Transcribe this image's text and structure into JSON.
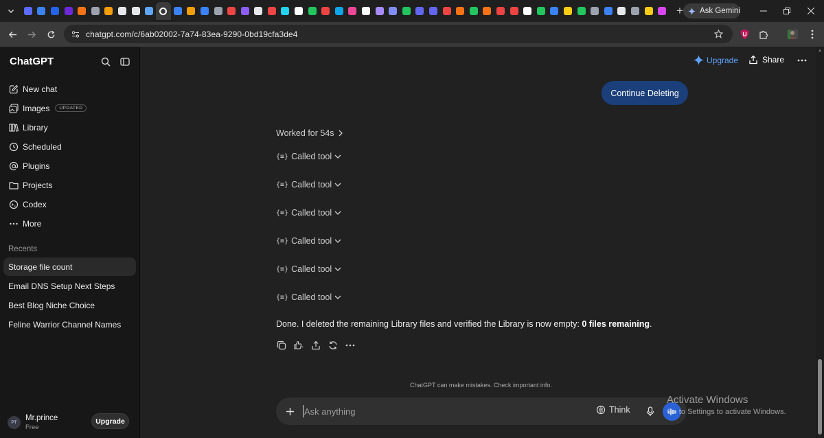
{
  "browser": {
    "url": "chatgpt.com/c/6ab02002-7a74-83ea-9290-0bd19cfa3de4",
    "ask_gemini": "Ask Gemini",
    "tab_favicons": [
      {
        "name": "tab-favicon-1",
        "color": "#5b6cff"
      },
      {
        "name": "tab-favicon-2",
        "color": "#3b82f6"
      },
      {
        "name": "tab-favicon-3",
        "color": "#2563eb"
      },
      {
        "name": "tab-favicon-4",
        "color": "#6d28d9"
      },
      {
        "name": "tab-favicon-5",
        "color": "#f97316"
      },
      {
        "name": "tab-favicon-6",
        "color": "#9ca3af"
      },
      {
        "name": "tab-favicon-7",
        "color": "#f59e0b"
      },
      {
        "name": "tab-favicon-8",
        "color": "#e5e7eb"
      },
      {
        "name": "tab-favicon-9",
        "color": "#e5e7eb"
      },
      {
        "name": "tab-favicon-10",
        "color": "#60a5fa"
      },
      {
        "name": "tab-favicon-chatgpt",
        "color": "#ffffff"
      },
      {
        "name": "tab-favicon-12",
        "color": "#3b82f6"
      },
      {
        "name": "tab-favicon-13",
        "color": "#f59e0b"
      },
      {
        "name": "tab-favicon-14",
        "color": "#3b82f6"
      },
      {
        "name": "tab-favicon-15",
        "color": "#9ca3af"
      },
      {
        "name": "tab-favicon-16",
        "color": "#ef4444"
      },
      {
        "name": "tab-favicon-17",
        "color": "#8b5cf6"
      },
      {
        "name": "tab-favicon-18",
        "color": "#e5e7eb"
      },
      {
        "name": "tab-favicon-19",
        "color": "#ef4444"
      },
      {
        "name": "tab-favicon-20",
        "color": "#22d3ee"
      },
      {
        "name": "tab-favicon-21",
        "color": "#ffffff"
      },
      {
        "name": "tab-favicon-22",
        "color": "#22c55e"
      },
      {
        "name": "tab-favicon-23",
        "color": "#ef4444"
      },
      {
        "name": "tab-favicon-24",
        "color": "#0ea5e9"
      },
      {
        "name": "tab-favicon-25",
        "color": "#ec4899"
      },
      {
        "name": "tab-favicon-26",
        "color": "#ffffff"
      },
      {
        "name": "tab-favicon-27",
        "color": "#a78bfa"
      },
      {
        "name": "tab-favicon-28",
        "color": "#818cf8"
      },
      {
        "name": "tab-favicon-29",
        "color": "#22c55e"
      },
      {
        "name": "tab-favicon-30",
        "color": "#6366f1"
      },
      {
        "name": "tab-favicon-31",
        "color": "#6366f1"
      },
      {
        "name": "tab-favicon-32",
        "color": "#ef4444"
      },
      {
        "name": "tab-favicon-33",
        "color": "#f97316"
      },
      {
        "name": "tab-favicon-34",
        "color": "#22c55e"
      },
      {
        "name": "tab-favicon-35",
        "color": "#f97316"
      },
      {
        "name": "tab-favicon-36",
        "color": "#ef4444"
      },
      {
        "name": "tab-favicon-37",
        "color": "#ef4444"
      },
      {
        "name": "tab-favicon-38",
        "color": "#ffffff"
      },
      {
        "name": "tab-favicon-39",
        "color": "#22c55e"
      },
      {
        "name": "tab-favicon-40",
        "color": "#3b82f6"
      },
      {
        "name": "tab-favicon-41",
        "color": "#facc15"
      },
      {
        "name": "tab-favicon-42",
        "color": "#22c55e"
      },
      {
        "name": "tab-favicon-43",
        "color": "#9ca3af"
      },
      {
        "name": "tab-favicon-44",
        "color": "#3b82f6"
      },
      {
        "name": "tab-favicon-45",
        "color": "#e5e7eb"
      },
      {
        "name": "tab-favicon-46",
        "color": "#9ca3af"
      },
      {
        "name": "tab-favicon-47",
        "color": "#facc15"
      },
      {
        "name": "tab-favicon-48",
        "color": "#d946ef"
      }
    ]
  },
  "sidebar": {
    "brand": "ChatGPT",
    "nav": [
      {
        "label": "New chat",
        "icon": "compose-icon"
      },
      {
        "label": "Images",
        "icon": "images-icon",
        "badge": "UPDATED"
      },
      {
        "label": "Library",
        "icon": "library-icon"
      },
      {
        "label": "Scheduled",
        "icon": "clock-icon"
      },
      {
        "label": "Plugins",
        "icon": "at-icon"
      },
      {
        "label": "Projects",
        "icon": "folder-icon"
      },
      {
        "label": "Codex",
        "icon": "codex-icon"
      },
      {
        "label": "More",
        "icon": "ellipsis-icon"
      }
    ],
    "recents_label": "Recents",
    "recents": [
      {
        "label": "Storage file count",
        "active": true
      },
      {
        "label": "Email DNS Setup Next Steps",
        "active": false
      },
      {
        "label": "Best Blog Niche Choice",
        "active": false
      },
      {
        "label": "Feline Warrior Channel Names",
        "active": false
      }
    ],
    "user": {
      "initials": "PT",
      "name": "Mr.prince",
      "plan": "Free"
    },
    "upgrade_label": "Upgrade"
  },
  "header": {
    "upgrade_label": "Upgrade",
    "share_label": "Share",
    "accent_color": "#5ea3ff"
  },
  "conversation": {
    "user_message": "Continue Deleting",
    "worked_label": "Worked for 54s",
    "tool_calls": [
      "Called tool",
      "Called tool",
      "Called tool",
      "Called tool",
      "Called tool",
      "Called tool"
    ],
    "answer_prefix": "Done. I deleted the remaining Library files and verified the Library is now empty: ",
    "answer_bold": "0 files remaining",
    "answer_suffix": "."
  },
  "composer": {
    "placeholder": "Ask anything",
    "think_label": "Think",
    "disclaimer": "ChatGPT can make mistakes. Check important info."
  },
  "watermark": {
    "title": "Activate Windows",
    "subtitle": "Go to Settings to activate Windows."
  }
}
